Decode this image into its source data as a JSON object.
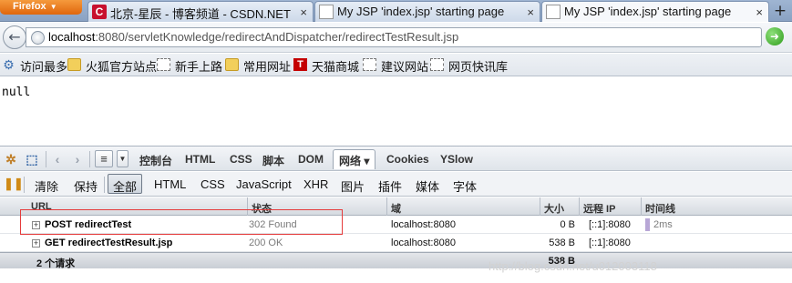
{
  "browser": {
    "app_button": "Firefox",
    "tabs": [
      {
        "title": "北京-星辰 - 博客频道 - CSDN.NET",
        "icon": "csdn-icon",
        "active": false
      },
      {
        "title": "My JSP 'index.jsp' starting page",
        "icon": "page-icon",
        "active": false
      },
      {
        "title": "My JSP 'index.jsp' starting page",
        "icon": "page-icon",
        "active": true
      }
    ],
    "new_tab": "+",
    "close_glyph": "×",
    "url_host": "localhost",
    "url_rest": ":8080/servletKnowledge/redirectAndDispatcher/redirectTestResult.jsp"
  },
  "bookmarks": [
    {
      "label": "访问最多",
      "icon": "gear-icon"
    },
    {
      "label": "火狐官方站点",
      "icon": "folder-icon"
    },
    {
      "label": "新手上路",
      "icon": "page-outline-icon"
    },
    {
      "label": "常用网址",
      "icon": "folder-icon"
    },
    {
      "label": "天猫商城",
      "icon": "tmall-icon"
    },
    {
      "label": "建议网站",
      "icon": "page-outline-icon"
    },
    {
      "label": "网页快讯库",
      "icon": "page-outline-icon"
    }
  ],
  "page": {
    "body_text": "null"
  },
  "firebug": {
    "panels": [
      "控制台",
      "HTML",
      "CSS",
      "脚本",
      "DOM",
      "网络",
      "Cookies",
      "YSlow"
    ],
    "active_panel": "网络 ▾",
    "net_buttons": [
      "清除",
      "保持",
      "全部",
      "HTML",
      "CSS",
      "JavaScript",
      "XHR",
      "图片",
      "插件",
      "媒体",
      "字体"
    ],
    "net_active": "全部",
    "columns": [
      "URL",
      "状态",
      "域",
      "大小",
      "远程 IP",
      "时间线"
    ],
    "rows": [
      {
        "url": "POST redirectTest",
        "status": "302 Found",
        "domain": "localhost:8080",
        "size": "0 B",
        "ip": "[::1]:8080",
        "time": "2ms"
      },
      {
        "url": "GET redirectTestResult.jsp",
        "status": "200 OK",
        "domain": "localhost:8080",
        "size": "538 B",
        "ip": "[::1]:8080",
        "time": ""
      }
    ],
    "summary": {
      "count": "2 个请求",
      "size": "538 B"
    }
  },
  "watermark": "http://blog.csdn.net/u012003118",
  "colors": {
    "highlight": "#e53b3b",
    "csdn": "#c8102e",
    "tmall": "#c40000"
  }
}
